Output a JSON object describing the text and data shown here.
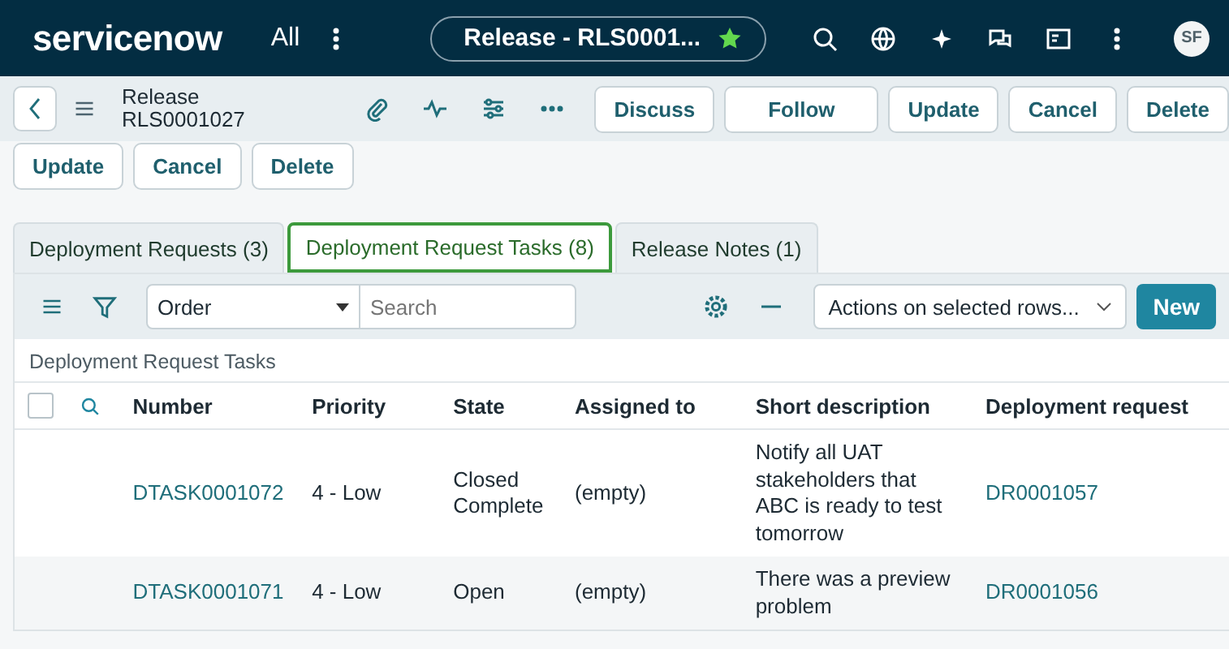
{
  "header": {
    "logo": "servicenow",
    "all_menu": "All",
    "context_pill": "Release - RLS0001...",
    "avatar": "SF"
  },
  "form_header": {
    "title_line_1": "Release",
    "title_line_2": "RLS0001027",
    "buttons": [
      "Discuss",
      "Follow",
      "Update",
      "Cancel",
      "Delete"
    ]
  },
  "bottom_buttons": [
    "Update",
    "Cancel",
    "Delete"
  ],
  "tabs": [
    {
      "label": "Deployment Requests (3)",
      "selected": false
    },
    {
      "label": "Deployment Request Tasks (8)",
      "selected": true
    },
    {
      "label": "Release Notes (1)",
      "selected": false
    }
  ],
  "list_toolbar": {
    "field_select": "Order",
    "search_placeholder": "Search",
    "actions_select": "Actions on selected rows...",
    "new_button": "New"
  },
  "list_title": "Deployment Request Tasks",
  "select_all": {
    "checked": false
  },
  "table": {
    "columns": [
      "Number",
      "Priority",
      "State",
      "Assigned to",
      "Short description",
      "Deployment request"
    ],
    "rows": [
      {
        "number": "DTASK0001072",
        "priority": "4 - Low",
        "state": "Closed Complete",
        "assigned_to": "(empty)",
        "short_description": "Notify all UAT stakeholders that ABC is ready to test tomorrow",
        "deployment_request": "DR0001057"
      },
      {
        "number": "DTASK0001071",
        "priority": "4 - Low",
        "state": "Open",
        "assigned_to": "(empty)",
        "short_description": "There was a preview problem",
        "deployment_request": "DR0001056"
      }
    ]
  }
}
